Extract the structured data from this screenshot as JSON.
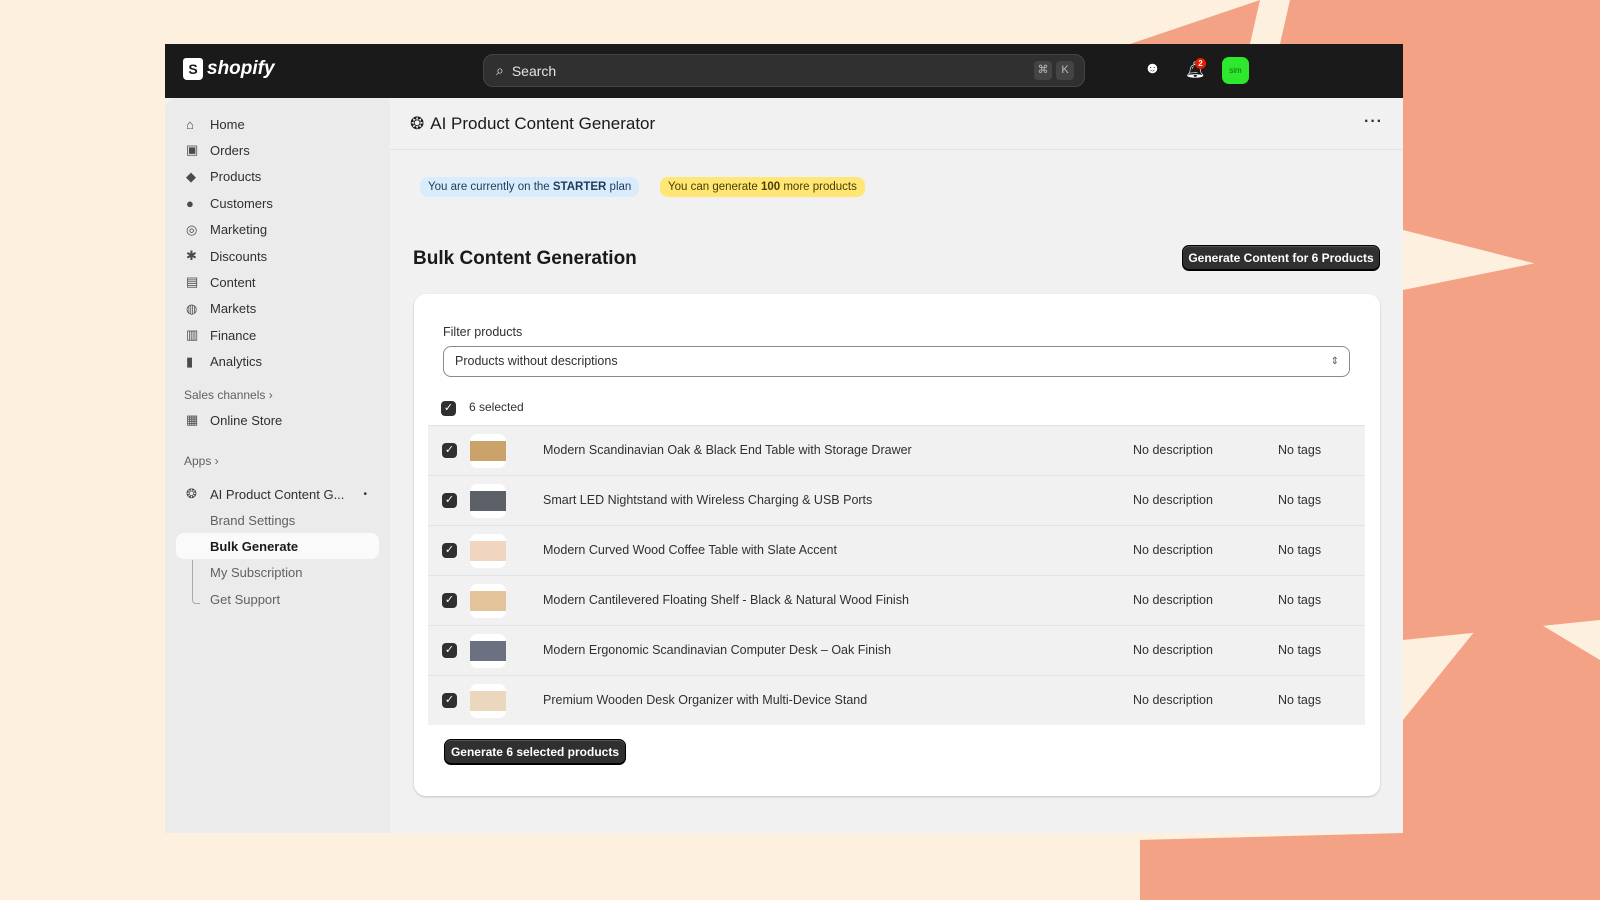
{
  "topbar": {
    "brand": "shopify",
    "search_placeholder": "Search",
    "shortcut_cmd": "⌘",
    "shortcut_key": "K",
    "notifications_count": "2",
    "avatar_initials": "sim"
  },
  "sidebar": {
    "items": [
      {
        "label": "Home",
        "icon": "⌂"
      },
      {
        "label": "Orders",
        "icon": "▣"
      },
      {
        "label": "Products",
        "icon": "◆"
      },
      {
        "label": "Customers",
        "icon": "●"
      },
      {
        "label": "Marketing",
        "icon": "◎"
      },
      {
        "label": "Discounts",
        "icon": "✱"
      },
      {
        "label": "Content",
        "icon": "▤"
      },
      {
        "label": "Markets",
        "icon": "◍"
      },
      {
        "label": "Finance",
        "icon": "▥"
      },
      {
        "label": "Analytics",
        "icon": "▮"
      }
    ],
    "sales_channels_label": "Sales channels ›",
    "online_store": "Online Store",
    "apps_label": "Apps ›",
    "app_name": "AI Product Content G...",
    "app_subitems": [
      "Brand Settings",
      "Bulk Generate",
      "My Subscription",
      "Get Support"
    ]
  },
  "page": {
    "title": "AI Product Content Generator",
    "plan_prefix": "You are currently on the",
    "plan_name": "STARTER",
    "plan_suffix": "plan",
    "quota_prefix": "You can generate",
    "quota_count": "100",
    "quota_suffix": "more products",
    "section_title": "Bulk Content Generation",
    "generate_button": "Generate Content for 6 Products",
    "filter_label": "Filter products",
    "filter_value": "Products without descriptions",
    "selected_count": "6 selected",
    "generate_selected_button": "Generate 6 selected products"
  },
  "products": [
    {
      "name": "Modern Scandinavian Oak & Black End Table with Storage Drawer",
      "description": "No description",
      "tags": "No tags",
      "color": "#c9a36a"
    },
    {
      "name": "Smart LED Nightstand with Wireless Charging & USB Ports",
      "description": "No description",
      "tags": "No tags",
      "color": "#5c6068"
    },
    {
      "name": "Modern Curved Wood Coffee Table with Slate Accent",
      "description": "No description",
      "tags": "No tags",
      "color": "#f0d6c0"
    },
    {
      "name": "Modern Cantilevered Floating Shelf - Black & Natural Wood Finish",
      "description": "No description",
      "tags": "No tags",
      "color": "#e3c49b"
    },
    {
      "name": "Modern Ergonomic Scandinavian Computer Desk – Oak Finish",
      "description": "No description",
      "tags": "No tags",
      "color": "#6b7180"
    },
    {
      "name": "Premium Wooden Desk Organizer with Multi-Device Stand",
      "description": "No description",
      "tags": "No tags",
      "color": "#ead7bd"
    }
  ]
}
